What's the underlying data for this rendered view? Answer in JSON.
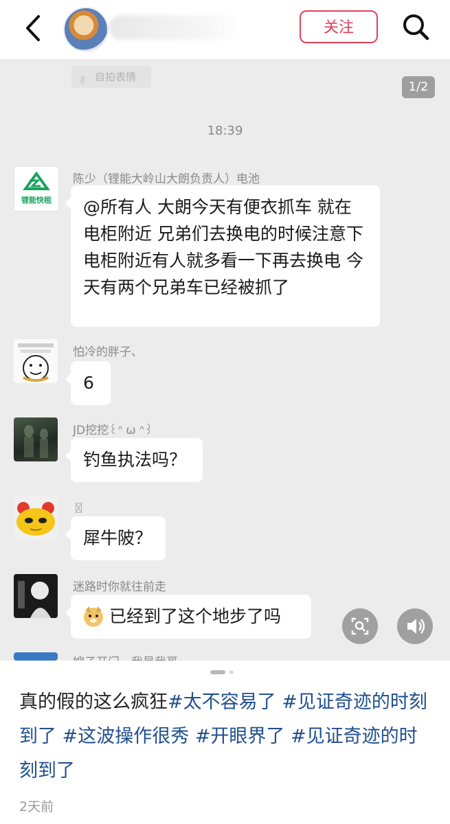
{
  "header": {
    "follow_label": "关注"
  },
  "chat": {
    "selfie_tag": "自拍表情",
    "page_indicator": "1/2",
    "time": "18:39",
    "messages": [
      {
        "sender": "陈少（锂能大岭山大朗负责人）电池",
        "avatar_text": "锂能快租",
        "text": "@所有人  大朗今天有便衣抓车 就在电柜附近  兄弟们去换电的时候注意下  电柜附近有人就多看一下再去换电 今天有两个兄弟车已经被抓了"
      },
      {
        "sender": "怕冷的胖子、",
        "text": "6"
      },
      {
        "sender": "JD挖挖꒰ᐢ ω ᐢ꒱",
        "text": "钓鱼执法吗？"
      },
      {
        "sender": "〿",
        "text": "犀牛陂？"
      },
      {
        "sender": "迷路时你就往前走",
        "text": "已经到了这个地步了吗"
      },
      {
        "sender": "嫂子开门，我是我哥"
      }
    ]
  },
  "caption": {
    "lead": "真的假的这么疯狂",
    "tags": [
      "#太不容易了",
      "#见证奇迹的时刻到了",
      "#这波操作很秀",
      "#开眼界了",
      "#见证奇迹的时刻到了"
    ],
    "date": "2天前"
  },
  "colors": {
    "accent": "#e0405a",
    "tag": "#1f4f8f",
    "chat_bg": "#ececec"
  }
}
